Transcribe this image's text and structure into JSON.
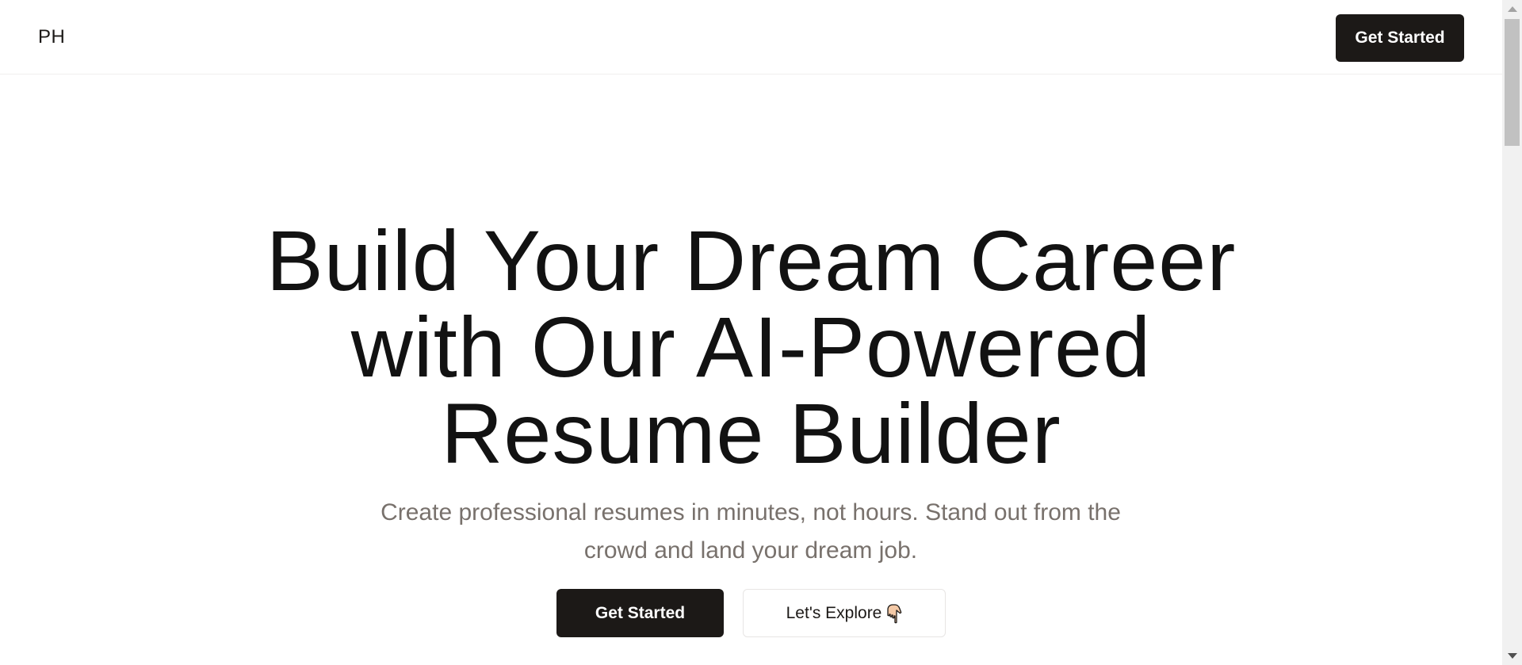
{
  "navbar": {
    "brand": "PH",
    "cta_label": "Get Started"
  },
  "hero": {
    "title_lines": [
      "Build Your Dream Career",
      "with Our AI-Powered",
      "Resume Builder"
    ],
    "subtitle_lines": [
      "Create professional resumes in minutes, not hours. Stand out from the",
      "crowd and land your dream job."
    ],
    "primary_cta_label": "Get Started",
    "secondary_cta_label": "Let's Explore",
    "secondary_cta_icon": "hand-pointing-down-icon"
  },
  "colors": {
    "primary_button": "#1c1917",
    "subtitle_text": "#78716c",
    "title_text": "#121212"
  }
}
